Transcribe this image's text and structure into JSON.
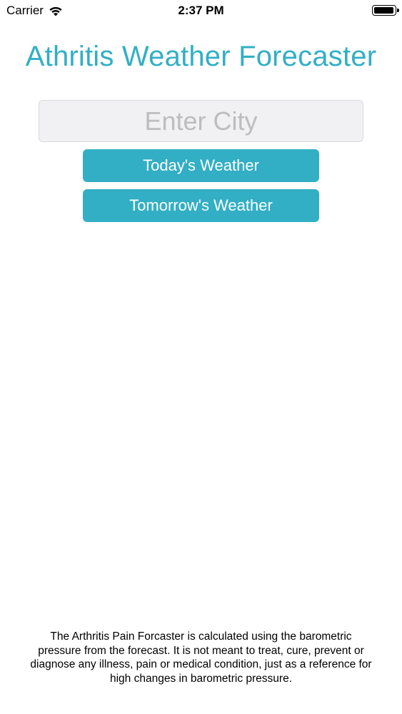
{
  "status_bar": {
    "carrier": "Carrier",
    "time": "2:37 PM",
    "battery_level": 0.95
  },
  "header": {
    "title": "Athritis Weather Forecaster"
  },
  "city_input": {
    "value": "",
    "placeholder": "Enter City"
  },
  "buttons": {
    "today_label": "Today's Weather",
    "tomorrow_label": "Tomorrow's Weather"
  },
  "footer": {
    "disclaimer": "The Arthritis Pain Forcaster is calculated using the barometric pressure from the forecast. It is not meant to treat, cure, prevent or diagnose any illness, pain or medical condition, just as a reference for high changes in barometric pressure."
  },
  "theme": {
    "accent": "#32AFC5",
    "input_bg": "#f1f1f3",
    "placeholder_color": "#bcbcc1"
  },
  "icons": {
    "wifi": "wifi-icon",
    "battery": "battery-icon"
  }
}
